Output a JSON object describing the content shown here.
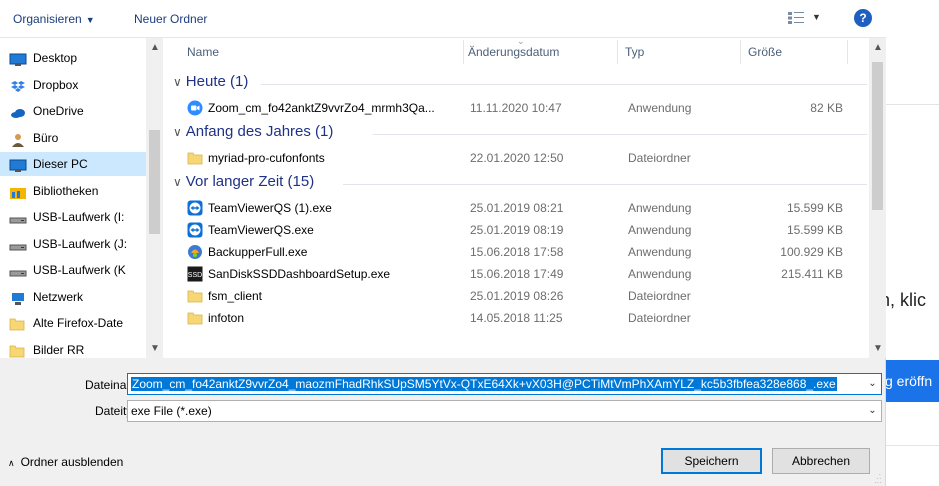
{
  "background_page": {
    "partial_text": "n, klic",
    "button_partial": "g eröffn"
  },
  "toolbar": {
    "organize_label": "Organisieren",
    "new_folder_label": "Neuer Ordner",
    "view_icon": "view-options-icon",
    "help_label": "?"
  },
  "nav": {
    "items": [
      {
        "label": "Desktop",
        "icon": "desktop-icon",
        "color": "#1f7bd6"
      },
      {
        "label": "Dropbox",
        "icon": "dropbox-icon",
        "color": "#2f7fe6"
      },
      {
        "label": "OneDrive",
        "icon": "onedrive-icon",
        "color": "#1565c0"
      },
      {
        "label": "Büro",
        "icon": "user-icon",
        "color": "#6b5a3a"
      },
      {
        "label": "Dieser PC",
        "icon": "computer-icon",
        "color": "#1f7bd6"
      },
      {
        "label": "Bibliotheken",
        "icon": "libraries-icon",
        "color": "#f4b400"
      },
      {
        "label": "USB-Laufwerk (I:",
        "icon": "drive-icon",
        "color": "#555555"
      },
      {
        "label": "USB-Laufwerk (J:",
        "icon": "drive-icon",
        "color": "#555555"
      },
      {
        "label": "USB-Laufwerk (K",
        "icon": "drive-icon",
        "color": "#555555"
      },
      {
        "label": "Netzwerk",
        "icon": "network-icon",
        "color": "#1f7bd6"
      },
      {
        "label": "Alte Firefox-Date",
        "icon": "folder-icon",
        "color": "#f7d774"
      },
      {
        "label": "Bilder RR",
        "icon": "folder-icon",
        "color": "#f7d774"
      }
    ],
    "selected_index": 4
  },
  "columns": {
    "name": "Name",
    "date": "Änderungsdatum",
    "type": "Typ",
    "size": "Größe"
  },
  "groups": [
    {
      "label": "Heute (1)",
      "rows": [
        {
          "name": "Zoom_cm_fo42anktZ9vvrZo4_mrmh3Qa...",
          "date": "11.11.2020 10:47",
          "type": "Anwendung",
          "size": "82 KB",
          "icon": "zoom-icon"
        }
      ]
    },
    {
      "label": "Anfang des Jahres (1)",
      "rows": [
        {
          "name": "myriad-pro-cufonfonts",
          "date": "22.01.2020 12:50",
          "type": "Dateiordner",
          "size": "",
          "icon": "folder-icon"
        }
      ]
    },
    {
      "label": "Vor langer Zeit (15)",
      "rows": [
        {
          "name": "TeamViewerQS (1).exe",
          "date": "25.01.2019 08:21",
          "type": "Anwendung",
          "size": "15.599 KB",
          "icon": "teamviewer-icon"
        },
        {
          "name": "TeamViewerQS.exe",
          "date": "25.01.2019 08:19",
          "type": "Anwendung",
          "size": "15.599 KB",
          "icon": "teamviewer-icon"
        },
        {
          "name": "BackupperFull.exe",
          "date": "15.06.2018 17:58",
          "type": "Anwendung",
          "size": "100.929 KB",
          "icon": "backupper-icon"
        },
        {
          "name": "SanDiskSSDDashboardSetup.exe",
          "date": "15.06.2018 17:49",
          "type": "Anwendung",
          "size": "215.411 KB",
          "icon": "sandisk-icon"
        },
        {
          "name": "fsm_client",
          "date": "25.01.2019 08:26",
          "type": "Dateiordner",
          "size": "",
          "icon": "folder-icon"
        },
        {
          "name": "infoton",
          "date": "14.05.2018 11:25",
          "type": "Dateiordner",
          "size": "",
          "icon": "folder-icon"
        }
      ]
    }
  ],
  "form": {
    "filename_label": "Dateiname:",
    "filename_value": "Zoom_cm_fo42anktZ9vvrZo4_maozmFhadRhkSUpSM5YtVx-QTxE64Xk+vX03H@PCTiMtVmPhXAmYLZ_kc5b3fbfea328e868_.exe",
    "filetype_label": "Dateityp:",
    "filetype_value": "exe File (*.exe)",
    "save_label": "Speichern",
    "cancel_label": "Abbrechen",
    "hide_folders_label": "Ordner ausblenden"
  },
  "colors": {
    "accent": "#0078d7",
    "group_header": "#1e3287",
    "nav_selected": "#cce8ff"
  }
}
